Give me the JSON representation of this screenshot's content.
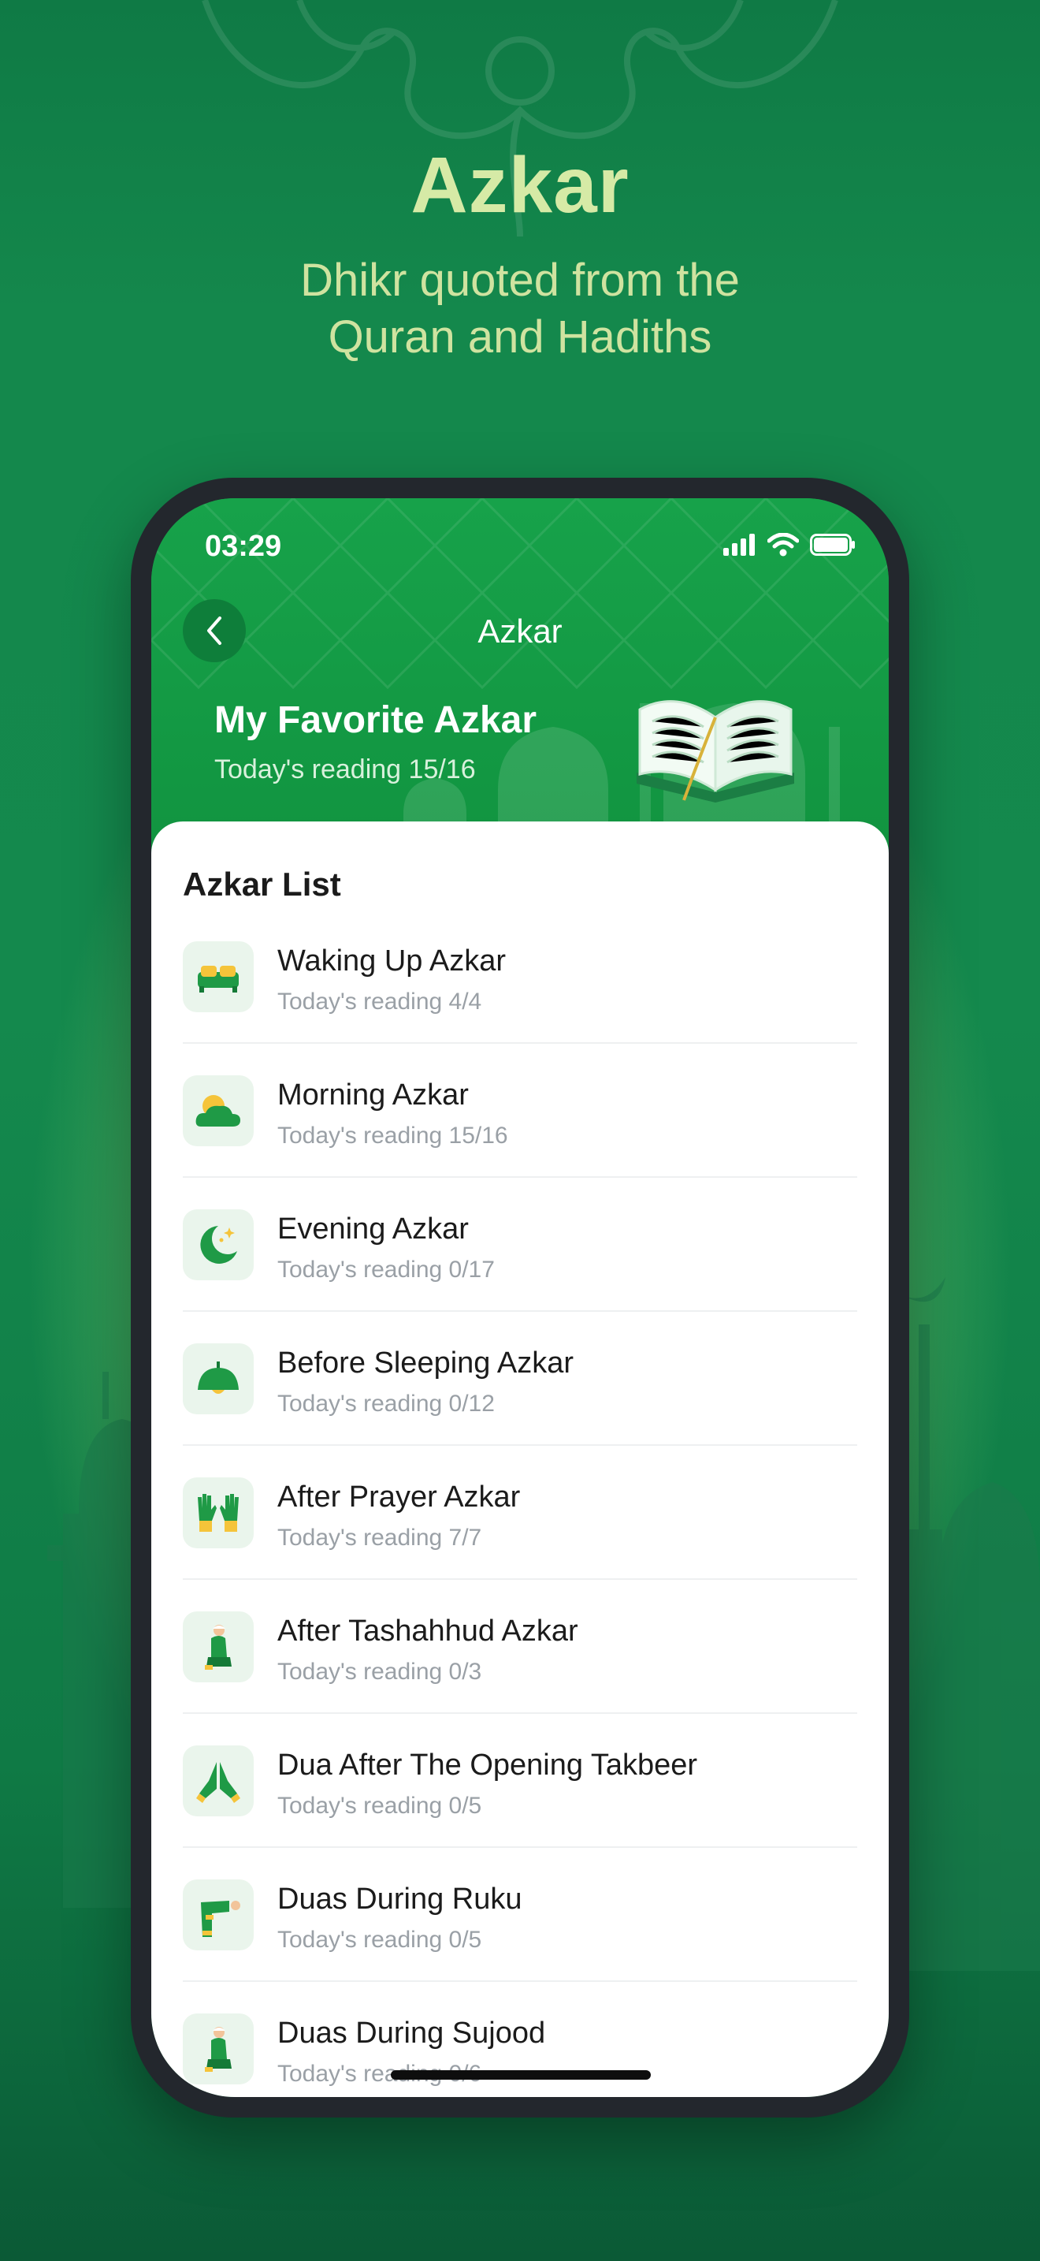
{
  "promo": {
    "title": "Azkar",
    "subtitle_line1": "Dhikr quoted from the",
    "subtitle_line2": "Quran and Hadiths"
  },
  "status_bar": {
    "time": "03:29",
    "icons": [
      "cellular-signal-icon",
      "wifi-icon",
      "battery-icon"
    ]
  },
  "nav": {
    "back_icon": "chevron-left-icon",
    "title": "Azkar"
  },
  "favorite": {
    "title": "My Favorite Azkar",
    "progress": "Today's reading 15/16",
    "illustration": "open-book-icon"
  },
  "list": {
    "title": "Azkar List",
    "items": [
      {
        "name": "Waking Up Azkar",
        "progress": "Today's reading 4/4",
        "icon": "bed-icon"
      },
      {
        "name": "Morning Azkar",
        "progress": "Today's reading 15/16",
        "icon": "sun-cloud-icon"
      },
      {
        "name": "Evening Azkar",
        "progress": "Today's reading 0/17",
        "icon": "crescent-moon-icon"
      },
      {
        "name": "Before Sleeping Azkar",
        "progress": "Today's reading 0/12",
        "icon": "lamp-icon"
      },
      {
        "name": "After Prayer Azkar",
        "progress": "Today's reading 7/7",
        "icon": "raised-hands-icon"
      },
      {
        "name": "After Tashahhud Azkar",
        "progress": "Today's reading 0/3",
        "icon": "sitting-person-icon"
      },
      {
        "name": "Dua After The Opening Takbeer",
        "progress": "Today's reading 0/5",
        "icon": "praying-hands-icon"
      },
      {
        "name": "Duas During Ruku",
        "progress": "Today's reading 0/5",
        "icon": "bowing-person-icon"
      },
      {
        "name": "Duas During Sujood",
        "progress": "Today's reading 0/6",
        "icon": "kneeling-person-icon"
      }
    ]
  },
  "colors": {
    "brand_green": "#16a046",
    "title_light": "#d6eaa6",
    "secondary_text": "#9aa0a6"
  }
}
